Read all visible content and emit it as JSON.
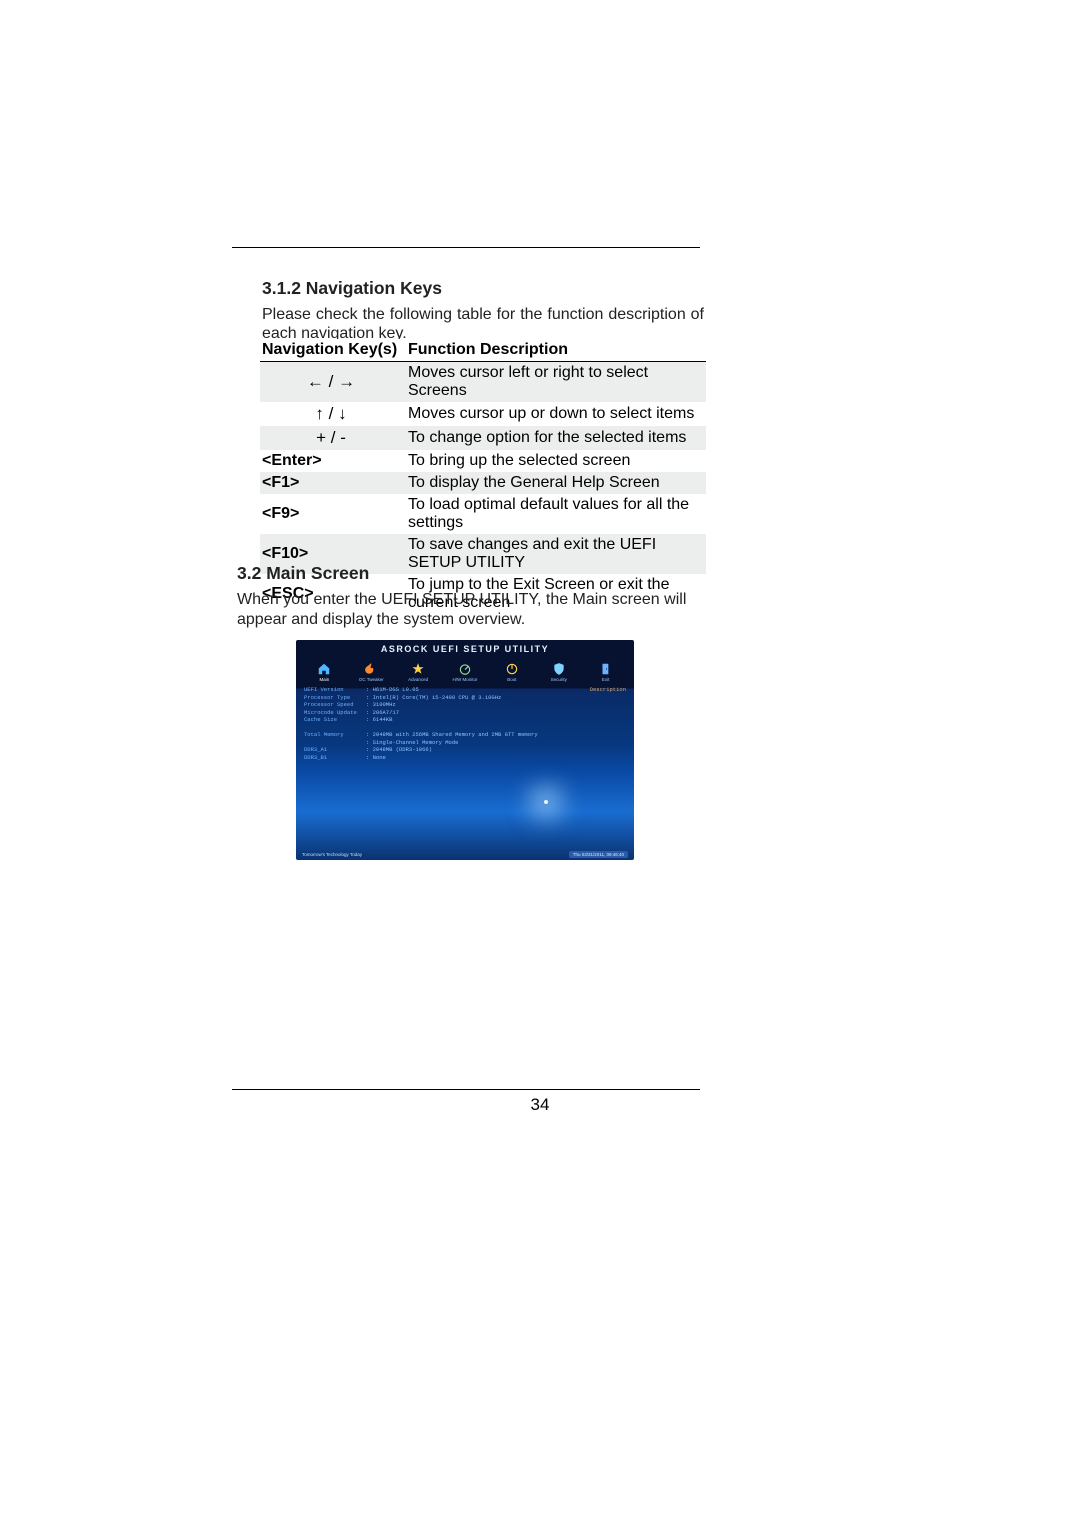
{
  "page_number": "34",
  "section1": {
    "heading": "3.1.2  Navigation Keys",
    "intro": "Please check the following table for the function description of each navigation key.",
    "table": {
      "head_key": "Navigation Key(s)",
      "head_desc": "Function Description",
      "rows": [
        {
          "key_glyph": "←  /  →",
          "bold": false,
          "center": true,
          "desc": "Moves cursor left or right to select Screens"
        },
        {
          "key_glyph": "↑  /  ↓",
          "bold": false,
          "center": true,
          "desc": "Moves cursor up or down to select items"
        },
        {
          "key_glyph": "+  /  -",
          "bold": false,
          "center": true,
          "desc": "To change option for the selected items"
        },
        {
          "key_glyph": "<Enter>",
          "bold": true,
          "center": false,
          "desc": "To bring up the selected screen"
        },
        {
          "key_glyph": "<F1>",
          "bold": true,
          "center": false,
          "desc": "To display the General Help Screen"
        },
        {
          "key_glyph": "<F9>",
          "bold": true,
          "center": false,
          "desc": "To load optimal default values for all the settings"
        },
        {
          "key_glyph": "<F10>",
          "bold": true,
          "center": false,
          "desc": "To save changes and exit the UEFI SETUP UTILITY"
        },
        {
          "key_glyph": "<ESC>",
          "bold": true,
          "center": false,
          "desc": "To jump to the Exit Screen or exit the current screen"
        }
      ]
    }
  },
  "section2": {
    "heading": "3.2  Main Screen",
    "intro": "When you enter the UEFI SETUP UTILITY, the Main screen will appear and display the system overview."
  },
  "bios": {
    "title": "ASROCK UEFI SETUP UTILITY",
    "tabs": [
      {
        "label": "Main",
        "icon": "home-icon",
        "active": true
      },
      {
        "label": "OC Tweaker",
        "icon": "flame-icon",
        "active": false
      },
      {
        "label": "Advanced",
        "icon": "star-icon",
        "active": false
      },
      {
        "label": "H/W Monitor",
        "icon": "speed-icon",
        "active": false
      },
      {
        "label": "Boot",
        "icon": "power-icon",
        "active": false
      },
      {
        "label": "Security",
        "icon": "shield-icon",
        "active": false
      },
      {
        "label": "Exit",
        "icon": "door-icon",
        "active": false
      }
    ],
    "info": {
      "uefi_version_label": "UEFI Version",
      "uefi_version": "H61M-DGS L0.05",
      "processor_type_label": "Processor Type",
      "processor_type": "Intel(R) Core(TM) i5-2400 CPU @ 3.10GHz",
      "processor_speed_label": "Processor Speed",
      "processor_speed": "3100MHz",
      "microcode_update_label": "Microcode Update",
      "microcode_update": "206A7/17",
      "cache_size_label": "Cache Size",
      "cache_size": "6144KB",
      "total_memory_label": "Total Memory",
      "total_memory": "2048MB with 256MB Shared Memory and 2MB GTT memory",
      "memory_mode": "Single-Channel Memory Mode",
      "ddr3_a1_label": "DDR3_A1",
      "ddr3_a1": "2048MB (DDR3-1066)",
      "ddr3_b1_label": "DDR3_B1",
      "ddr3_b1": "None"
    },
    "sidebar_label": "Description",
    "footer_tagline": "Tomorrow's Technology Today",
    "footer_datetime": "Thu 03/31/2011, 09:46:40"
  }
}
